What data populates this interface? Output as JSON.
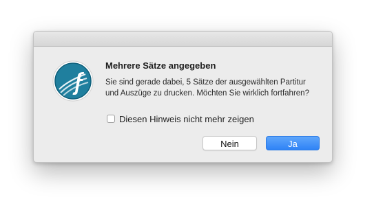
{
  "dialog": {
    "title": "Mehrere Sätze angegeben",
    "message": "Sie sind gerade dabei, 5 Sätze der ausgewählten Partitur und Auszüge zu drucken. Möchten Sie wirklich fortfahren?",
    "checkbox_label": "Diesen Hinweis nicht mehr zeigen",
    "checkbox_checked": false,
    "app_icon": "finale-app-icon",
    "buttons": {
      "no_label": "Nein",
      "yes_label": "Ja"
    }
  },
  "colors": {
    "accent": "#2f83f6",
    "dialog_background": "#ececec",
    "icon_teal": "#1f7f9e"
  }
}
